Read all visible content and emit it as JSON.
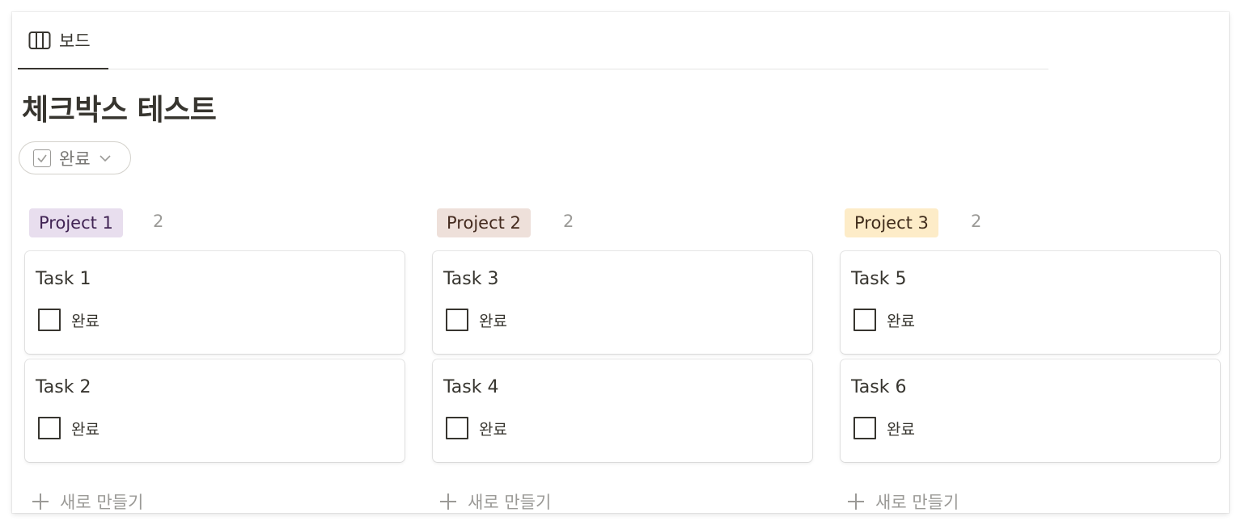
{
  "tab": {
    "label": "보드",
    "icon": "board-view-icon"
  },
  "page_title": "체크박스 테스트",
  "filter": {
    "label": "완료",
    "icon": "checkbox-icon",
    "caret": "chevron-down-icon"
  },
  "columns": [
    {
      "name": "Project 1",
      "count": "2",
      "bg": "#e8deee",
      "fg": "#412454",
      "cards": [
        {
          "title": "Task 1",
          "prop": "완료",
          "checked": false
        },
        {
          "title": "Task 2",
          "prop": "완료",
          "checked": false
        }
      ],
      "new_label": "새로 만들기"
    },
    {
      "name": "Project 2",
      "count": "2",
      "bg": "#eee0da",
      "fg": "#442a1e",
      "cards": [
        {
          "title": "Task 3",
          "prop": "완료",
          "checked": false
        },
        {
          "title": "Task 4",
          "prop": "완료",
          "checked": false
        }
      ],
      "new_label": "새로 만들기"
    },
    {
      "name": "Project 3",
      "count": "2",
      "bg": "#fdecc8",
      "fg": "#402c1b",
      "cards": [
        {
          "title": "Task 5",
          "prop": "완료",
          "checked": false
        },
        {
          "title": "Task 6",
          "prop": "완료",
          "checked": false
        }
      ],
      "new_label": "새로 만들기"
    }
  ]
}
